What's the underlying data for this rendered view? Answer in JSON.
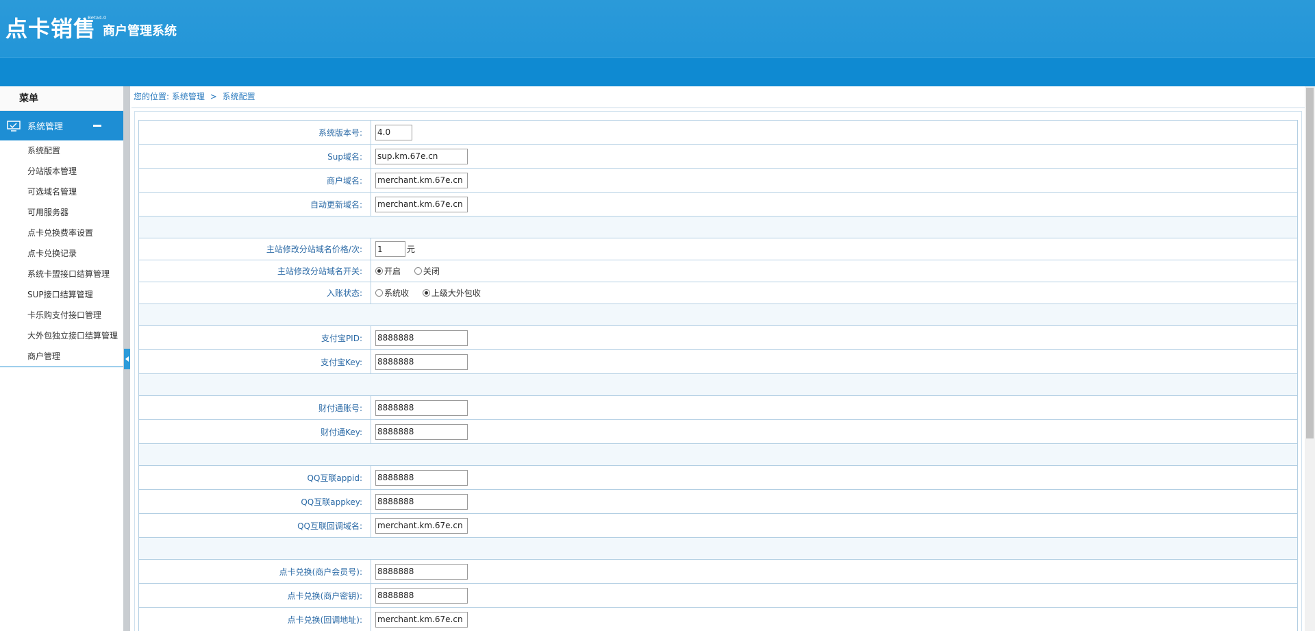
{
  "header": {
    "logo_main": "点卡销售",
    "logo_sub": "商户管理系统",
    "logo_version": "Beta4.0"
  },
  "sidebar": {
    "menu_title": "菜单",
    "group_label": "系统管理",
    "items": [
      {
        "label": "系统配置"
      },
      {
        "label": "分站版本管理"
      },
      {
        "label": "可选域名管理"
      },
      {
        "label": "可用服务器"
      },
      {
        "label": "点卡兑换费率设置"
      },
      {
        "label": "点卡兑换记录"
      },
      {
        "label": "系统卡盟接口结算管理"
      },
      {
        "label": "SUP接口结算管理"
      },
      {
        "label": "卡乐购支付接口管理"
      },
      {
        "label": "大外包独立接口结算管理"
      },
      {
        "label": "商户管理"
      }
    ]
  },
  "breadcrumb": {
    "prefix": "您的位置:",
    "level1": "系统管理",
    "separator": ">",
    "level2": "系统配置"
  },
  "form": {
    "version": {
      "label": "系统版本号:",
      "value": "4.0"
    },
    "sup_domain": {
      "label": "Sup域名:",
      "value": "sup.km.67e.cn"
    },
    "merchant_domain": {
      "label": "商户域名:",
      "value": "merchant.km.67e.cn"
    },
    "autoupdate_domain": {
      "label": "自动更新域名:",
      "value": "merchant.km.67e.cn"
    },
    "substation_price": {
      "label": "主站修改分站域名价格/次:",
      "value": "1",
      "unit": "元"
    },
    "substation_switch": {
      "label": "主站修改分站域名开关:",
      "opt_on": "开启",
      "opt_off": "关闭",
      "selected": "开启"
    },
    "account_status": {
      "label": "入账状态:",
      "opt_a": "系统收",
      "opt_b": "上级大外包收",
      "selected": "上级大外包收"
    },
    "alipay_pid": {
      "label": "支付宝PID:",
      "value": "8888888"
    },
    "alipay_key": {
      "label": "支付宝Key:",
      "value": "8888888"
    },
    "tenpay_account": {
      "label": "财付通账号:",
      "value": "8888888"
    },
    "tenpay_key": {
      "label": "财付通Key:",
      "value": "8888888"
    },
    "qq_appid": {
      "label": "QQ互联appid:",
      "value": "8888888"
    },
    "qq_appkey": {
      "label": "QQ互联appkey:",
      "value": "8888888"
    },
    "qq_callback": {
      "label": "QQ互联回调域名:",
      "value": "merchant.km.67e.cn"
    },
    "card_member": {
      "label": "点卡兑换(商户会员号):",
      "value": "8888888"
    },
    "card_secret": {
      "label": "点卡兑换(商户密钥):",
      "value": "8888888"
    },
    "card_callback": {
      "label": "点卡兑换(回调地址):",
      "value": "merchant.km.67e.cn"
    }
  },
  "colors": {
    "header_blue": "#2b9ad9",
    "accent_blue": "#1e8ed4",
    "label_text": "#2b6aa6"
  }
}
